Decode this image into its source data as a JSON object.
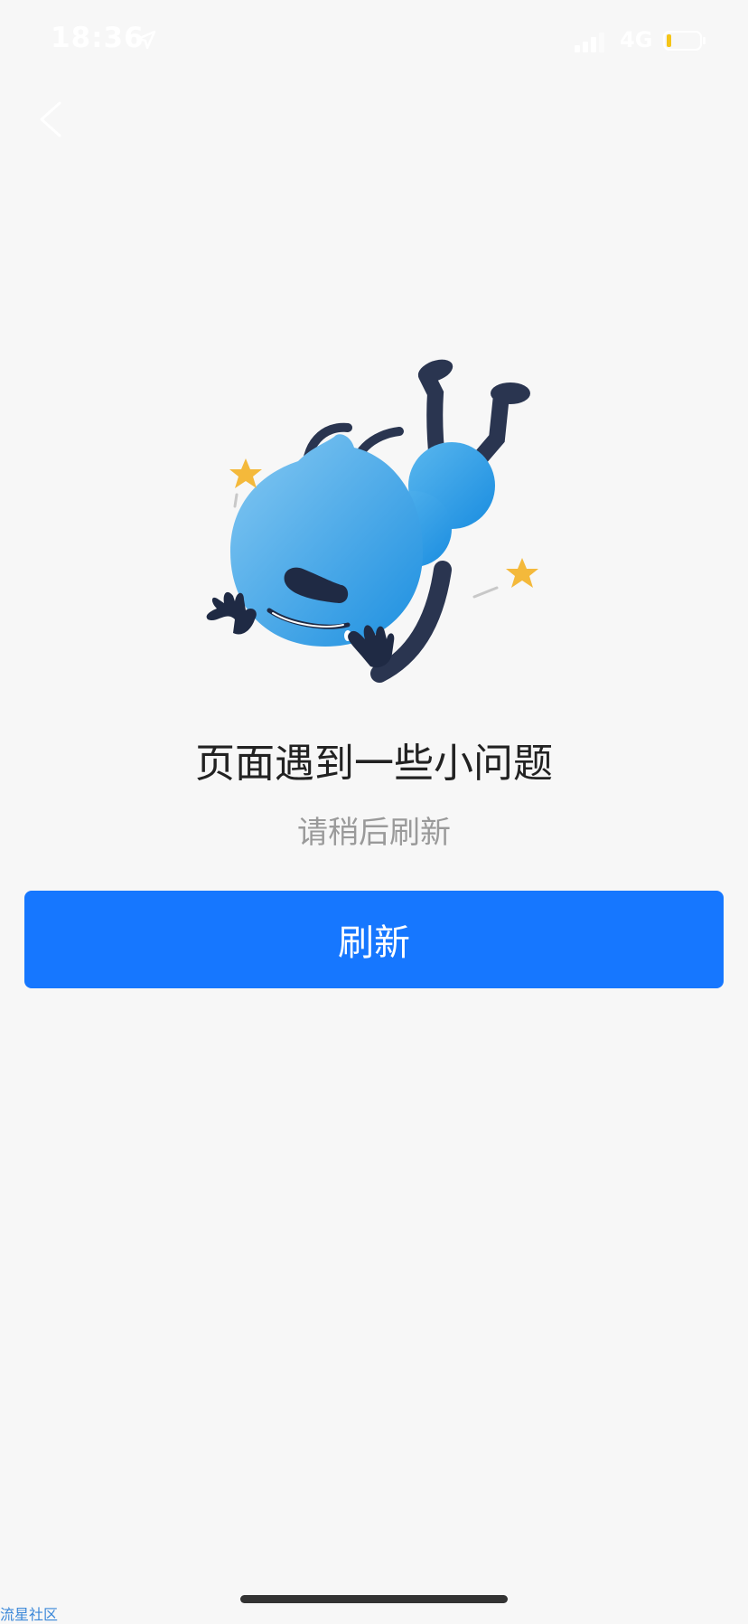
{
  "status_bar": {
    "time": "18:36",
    "network": "4G",
    "icons": [
      "location-arrow-icon",
      "signal-icon",
      "battery-icon"
    ],
    "battery_color": "#f5c518"
  },
  "nav": {
    "back_icon": "chevron-left-icon"
  },
  "illustration": {
    "name": "fallen-ant-mascot",
    "body_color": "#37a3e8",
    "star_color": "#f4b93b"
  },
  "error": {
    "title": "页面遇到一些小问题",
    "subtitle": "请稍后刷新"
  },
  "refresh_button": {
    "label": "刷新",
    "color": "#1677ff"
  },
  "watermark": "流星社区"
}
